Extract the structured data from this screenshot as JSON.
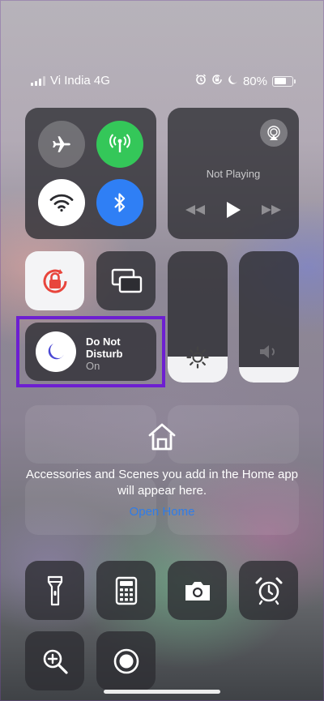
{
  "status_bar": {
    "carrier": "Vi India 4G",
    "battery_percent": "80%",
    "battery_level": 0.8,
    "icons": [
      "alarm-icon",
      "orientation-lock-icon",
      "moon-icon"
    ]
  },
  "connectivity": {
    "airplane": {
      "icon": "airplane-icon",
      "active": false
    },
    "cellular": {
      "icon": "antenna-icon",
      "active": true,
      "color": "#34c759"
    },
    "wifi": {
      "icon": "wifi-icon",
      "active": true
    },
    "bluetooth": {
      "icon": "bluetooth-icon",
      "active": true,
      "color": "#2f7ff5"
    }
  },
  "media": {
    "status": "Not Playing",
    "icons": [
      "airplay-icon",
      "rewind-icon",
      "play-icon",
      "fast-forward-icon"
    ]
  },
  "toggles": {
    "orientation_lock": {
      "icon": "orientation-lock-icon",
      "active": true,
      "color": "#e8453c"
    },
    "screen_mirroring": {
      "icon": "screen-mirroring-icon"
    }
  },
  "focus": {
    "title": "Do Not Disturb",
    "state": "On",
    "icon": "moon-icon",
    "accent": "#4b48d4",
    "highlight_color": "#6d1fd1"
  },
  "sliders": {
    "brightness": {
      "icon": "sun-icon",
      "level": 0.2
    },
    "volume": {
      "icon": "speaker-icon",
      "level": 0.12
    }
  },
  "home": {
    "icon": "home-icon",
    "message": "Accessories and Scenes you add in the Home app will appear here.",
    "link": "Open Home"
  },
  "bottom_controls": [
    "flashlight-icon",
    "calculator-icon",
    "camera-icon",
    "alarm-clock-icon",
    "magnifier-icon",
    "screen-record-icon"
  ]
}
